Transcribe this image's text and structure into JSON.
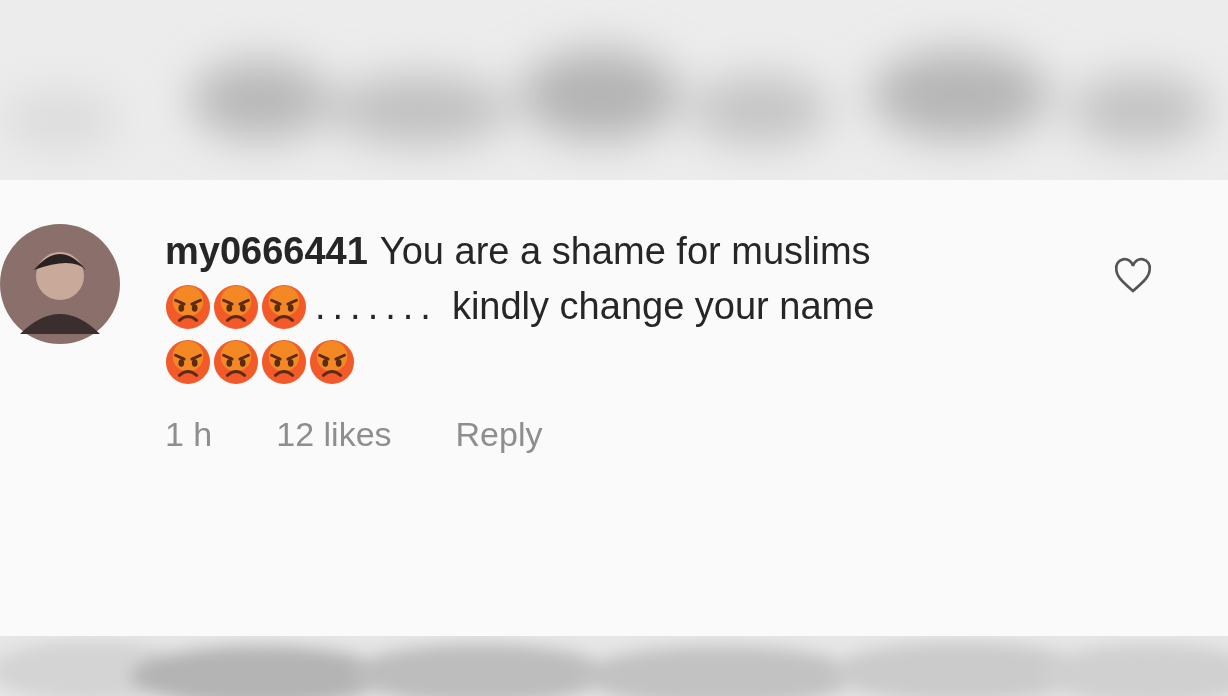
{
  "comment": {
    "username": "my0666441",
    "lines": [
      [
        {
          "kind": "text",
          "text": "You are a shame for muslims"
        }
      ],
      [
        {
          "kind": "emoji"
        },
        {
          "kind": "emoji"
        },
        {
          "kind": "emoji"
        },
        {
          "kind": "dots",
          "text": "......."
        },
        {
          "kind": "text",
          "text": "kindly change your name"
        }
      ],
      [
        {
          "kind": "emoji"
        },
        {
          "kind": "emoji"
        },
        {
          "kind": "emoji"
        },
        {
          "kind": "emoji"
        }
      ]
    ],
    "time": "1 h",
    "likes": "12 likes",
    "reply": "Reply",
    "liked": false
  }
}
